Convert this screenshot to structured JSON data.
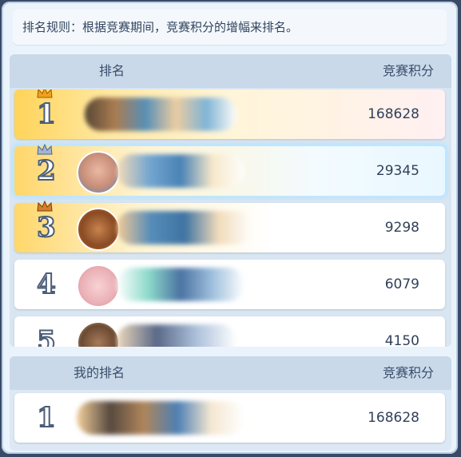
{
  "rule_text": "排名规则：根据竞赛期间，竞赛积分的增幅来排名。",
  "board": {
    "header_rank": "排名",
    "header_score": "竞赛积分",
    "rows": [
      {
        "rank": "1",
        "score": "168628"
      },
      {
        "rank": "2",
        "score": "29345"
      },
      {
        "rank": "3",
        "score": "9298"
      },
      {
        "rank": "4",
        "score": "6079"
      },
      {
        "rank": "5",
        "score": "4150"
      }
    ]
  },
  "mine": {
    "header_rank": "我的排名",
    "header_score": "竞赛积分",
    "rank": "1",
    "score": "168628"
  }
}
